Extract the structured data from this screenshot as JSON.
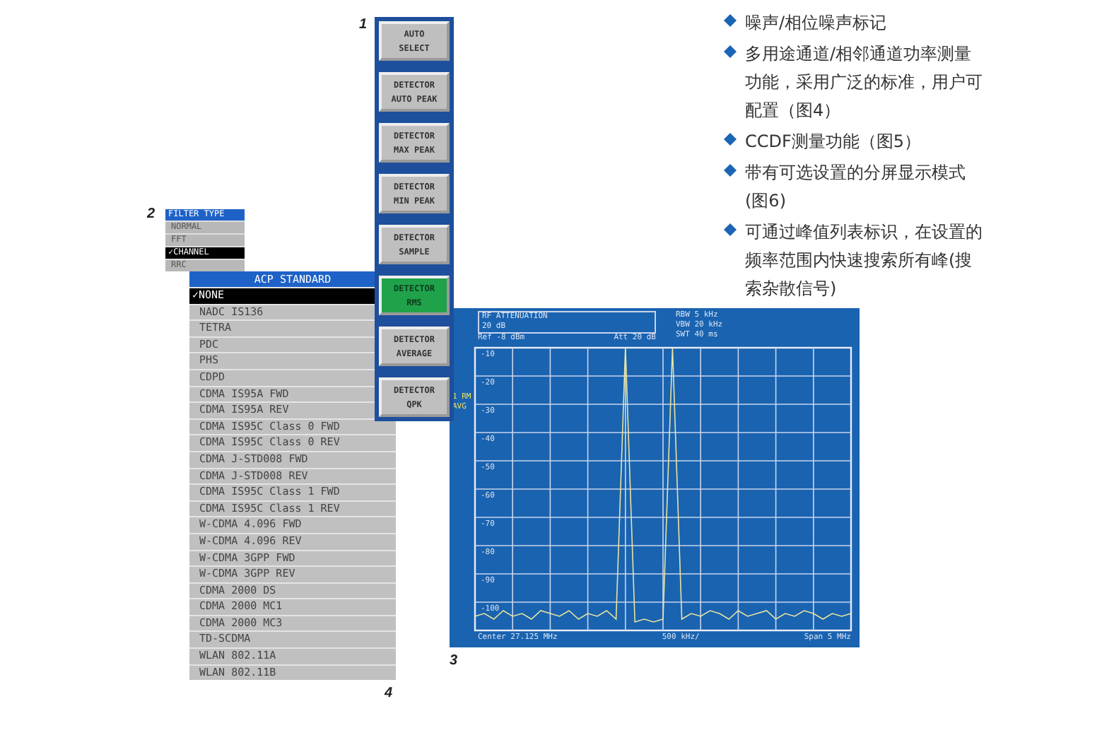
{
  "figure_labels": [
    "1",
    "2",
    "3",
    "4"
  ],
  "softkeys": [
    {
      "lines": [
        "AUTO",
        "SELECT"
      ],
      "selected": false
    },
    {
      "lines": [
        "DETECTOR",
        "AUTO PEAK"
      ],
      "selected": false
    },
    {
      "lines": [
        "DETECTOR",
        "MAX PEAK"
      ],
      "selected": false
    },
    {
      "lines": [
        "DETECTOR",
        "MIN PEAK"
      ],
      "selected": false
    },
    {
      "lines": [
        "DETECTOR",
        "SAMPLE"
      ],
      "selected": false
    },
    {
      "lines": [
        "DETECTOR",
        "RMS"
      ],
      "selected": true
    },
    {
      "lines": [
        "DETECTOR",
        "AVERAGE"
      ],
      "selected": false
    },
    {
      "lines": [
        "DETECTOR",
        "QPK"
      ],
      "selected": false
    }
  ],
  "filter_menu": {
    "title": "FILTER TYPE",
    "items": [
      {
        "label": "NORMAL",
        "selected": false
      },
      {
        "label": "FFT",
        "selected": false
      },
      {
        "label": "✓CHANNEL",
        "selected": true
      },
      {
        "label": "RRC",
        "selected": false
      }
    ]
  },
  "acp_menu": {
    "title": "ACP STANDARD",
    "items": [
      {
        "label": "✓NONE",
        "selected": true
      },
      {
        "label": "NADC IS136",
        "selected": false
      },
      {
        "label": "TETRA",
        "selected": false
      },
      {
        "label": "PDC",
        "selected": false
      },
      {
        "label": "PHS",
        "selected": false
      },
      {
        "label": "CDPD",
        "selected": false
      },
      {
        "label": "CDMA IS95A FWD",
        "selected": false
      },
      {
        "label": "CDMA IS95A REV",
        "selected": false
      },
      {
        "label": "CDMA IS95C Class 0 FWD",
        "selected": false
      },
      {
        "label": "CDMA IS95C Class 0 REV",
        "selected": false
      },
      {
        "label": "CDMA J-STD008 FWD",
        "selected": false
      },
      {
        "label": "CDMA J-STD008 REV",
        "selected": false
      },
      {
        "label": "CDMA IS95C Class 1 FWD",
        "selected": false
      },
      {
        "label": "CDMA IS95C Class 1 REV",
        "selected": false
      },
      {
        "label": "W-CDMA 4.096 FWD",
        "selected": false
      },
      {
        "label": "W-CDMA 4.096 REV",
        "selected": false
      },
      {
        "label": "W-CDMA 3GPP FWD",
        "selected": false
      },
      {
        "label": "W-CDMA 3GPP REV",
        "selected": false
      },
      {
        "label": "CDMA 2000 DS",
        "selected": false
      },
      {
        "label": "CDMA 2000 MC1",
        "selected": false
      },
      {
        "label": "CDMA 2000 MC3",
        "selected": false
      },
      {
        "label": "TD-SCDMA",
        "selected": false
      },
      {
        "label": "WLAN 802.11A",
        "selected": false
      },
      {
        "label": "WLAN 802.11B",
        "selected": false
      }
    ]
  },
  "analyzer": {
    "attenuation_label": "RF ATTENUATION",
    "attenuation_value": "20 dB",
    "ref": "Ref -8 dBm",
    "att": "Att 20 dB",
    "settings": [
      "RBW 5 kHz",
      "VBW 20 kHz",
      "SWT 40 ms"
    ],
    "side_labels": [
      "1 RM",
      "AVG"
    ],
    "chart_data": {
      "type": "line",
      "grid": true,
      "ylim": [
        -110,
        -10
      ],
      "yticks": [
        -10,
        -20,
        -30,
        -40,
        -50,
        -60,
        -70,
        -80,
        -90,
        -100
      ],
      "series": [
        {
          "color": "#e8e4a0",
          "values": [
            -105,
            -104,
            -106,
            -103,
            -105,
            -104,
            -106,
            -103,
            -104,
            -105,
            -103,
            -106,
            -104,
            -105,
            -103,
            -106,
            -10,
            -107,
            -106,
            -107,
            -106,
            -10,
            -106,
            -104,
            -105,
            -103,
            -104,
            -106,
            -103,
            -105,
            -104,
            -103,
            -106,
            -104,
            -105,
            -103,
            -104,
            -106,
            -104,
            -105,
            -104
          ]
        }
      ]
    },
    "center": "Center 27.125 MHz",
    "div": "500 kHz/",
    "span": "Span 5 MHz"
  },
  "features": [
    "噪声/相位噪声标记",
    "多用途通道/相邻通道功率测量功能，采用广泛的标准，用户可配置（图4）",
    "CCDF测量功能（图5）",
    "带有可选设置的分屏显示模式(图6)",
    "可通过峰值列表标识，在设置的频率范围内快速搜索所有峰(搜索杂散信号)"
  ]
}
